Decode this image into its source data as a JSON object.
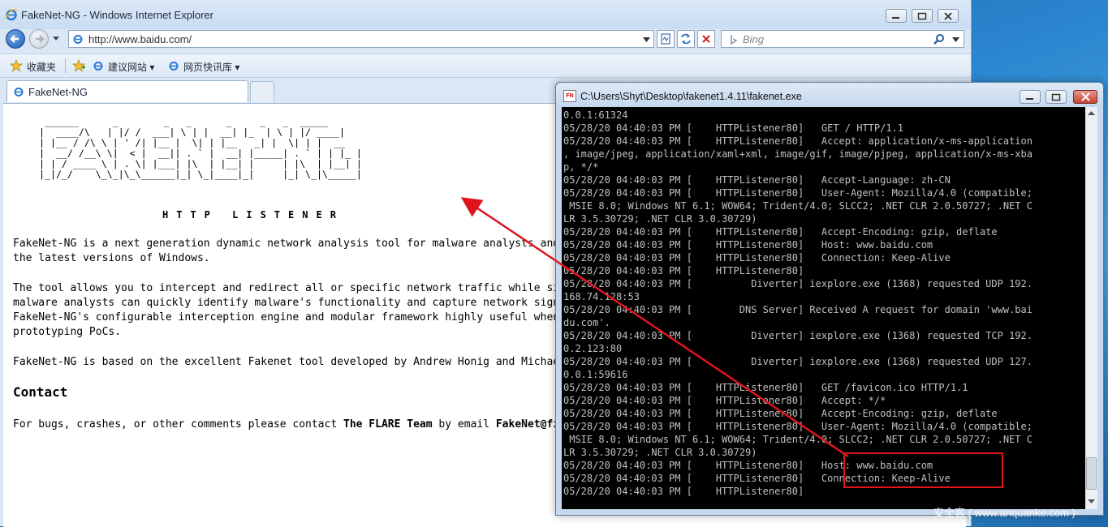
{
  "ie": {
    "title": "FakeNet-NG - Windows Internet Explorer",
    "address": "http://www.baidu.com/",
    "search_placeholder": "Bing",
    "favorites_label": "收藏夹",
    "fav_links": [
      "建议网站 ▾",
      "网页快讯库 ▾"
    ],
    "tab_label": "FakeNet-NG"
  },
  "page": {
    "ascii_banner": " ______      _        _   _      _     _   _  _____\n|  ____/\\   | |/ /  ___| \\ | |  __| |_  | \\ | |/ ____|\n| |__ / /\\ \\ | ' /| |__ |  \\| | |__   _| |  \\| | |  __\n|  __/ /__\\ \\|  < |  __|| . ` |  __| |_____| . ` | | |_ |\n| | / ____ \\ | . \\| |___| |\\  | |__| |     | |\\  | |__| |\n|_|/_/    \\_\\_|\\_\\______|_| \\_|____|_|     |_| \\_|\\_____|",
    "subtitle": "HTTP LISTENER",
    "para1": "FakeNet-NG is a next generation dynamic network analysis tool for malware analysts and penetration testers. It is open source and designed for\nthe latest versions of Windows.",
    "para2": "The tool allows you to intercept and redirect all or specific network traffic while simulating legitimate network services. Using FakeNet-NG,\nmalware analysts can quickly identify malware's functionality and capture network signatures. Penetration testers and bug hunters will find\nFakeNet-NG's configurable interception engine and modular framework highly useful when testing application's specific functionality and\nprototyping PoCs.",
    "para3": "FakeNet-NG is based on the excellent Fakenet tool developed by Andrew Honig and Michael Sikorski.",
    "contact_heading": "Contact",
    "contact_prefix": "For bugs, crashes, or other comments please contact ",
    "contact_team": "The FLARE Team",
    "contact_mid": " by email ",
    "contact_email": "FakeNet@fireeye.com"
  },
  "console": {
    "title": "C:\\Users\\Shyt\\Desktop\\fakenet1.4.11\\fakenet.exe",
    "icon_text": "FN",
    "lines": "0.0.1:61324\n05/28/20 04:40:03 PM [    HTTPListener80]   GET / HTTP/1.1\n05/28/20 04:40:03 PM [    HTTPListener80]   Accept: application/x-ms-application\n, image/jpeg, application/xaml+xml, image/gif, image/pjpeg, application/x-ms-xba\np, */*\n05/28/20 04:40:03 PM [    HTTPListener80]   Accept-Language: zh-CN\n05/28/20 04:40:03 PM [    HTTPListener80]   User-Agent: Mozilla/4.0 (compatible;\n MSIE 8.0; Windows NT 6.1; WOW64; Trident/4.0; SLCC2; .NET CLR 2.0.50727; .NET C\nLR 3.5.30729; .NET CLR 3.0.30729)\n05/28/20 04:40:03 PM [    HTTPListener80]   Accept-Encoding: gzip, deflate\n05/28/20 04:40:03 PM [    HTTPListener80]   Host: www.baidu.com\n05/28/20 04:40:03 PM [    HTTPListener80]   Connection: Keep-Alive\n05/28/20 04:40:03 PM [    HTTPListener80]\n05/28/20 04:40:03 PM [          Diverter] iexplore.exe (1368) requested UDP 192.\n168.74.128:53\n05/28/20 04:40:03 PM [        DNS Server] Received A request for domain 'www.bai\ndu.com'.\n05/28/20 04:40:03 PM [          Diverter] iexplore.exe (1368) requested TCP 192.\n0.2.123:80\n05/28/20 04:40:03 PM [          Diverter] iexplore.exe (1368) requested UDP 127.\n0.0.1:59616\n05/28/20 04:40:03 PM [    HTTPListener80]   GET /favicon.ico HTTP/1.1\n05/28/20 04:40:03 PM [    HTTPListener80]   Accept: */*\n05/28/20 04:40:03 PM [    HTTPListener80]   Accept-Encoding: gzip, deflate\n05/28/20 04:40:03 PM [    HTTPListener80]   User-Agent: Mozilla/4.0 (compatible;\n MSIE 8.0; Windows NT 6.1; WOW64; Trident/4.0; SLCC2; .NET CLR 2.0.50727; .NET C\nLR 3.5.30729; .NET CLR 3.0.30729)\n05/28/20 04:40:03 PM [    HTTPListener80]   Host: www.baidu.com\n05/28/20 04:40:03 PM [    HTTPListener80]   Connection: Keep-Alive\n05/28/20 04:40:03 PM [    HTTPListener80]"
  },
  "annotation_color": "#e0141e",
  "watermark": "安全客 ( www.anquanke.com )"
}
